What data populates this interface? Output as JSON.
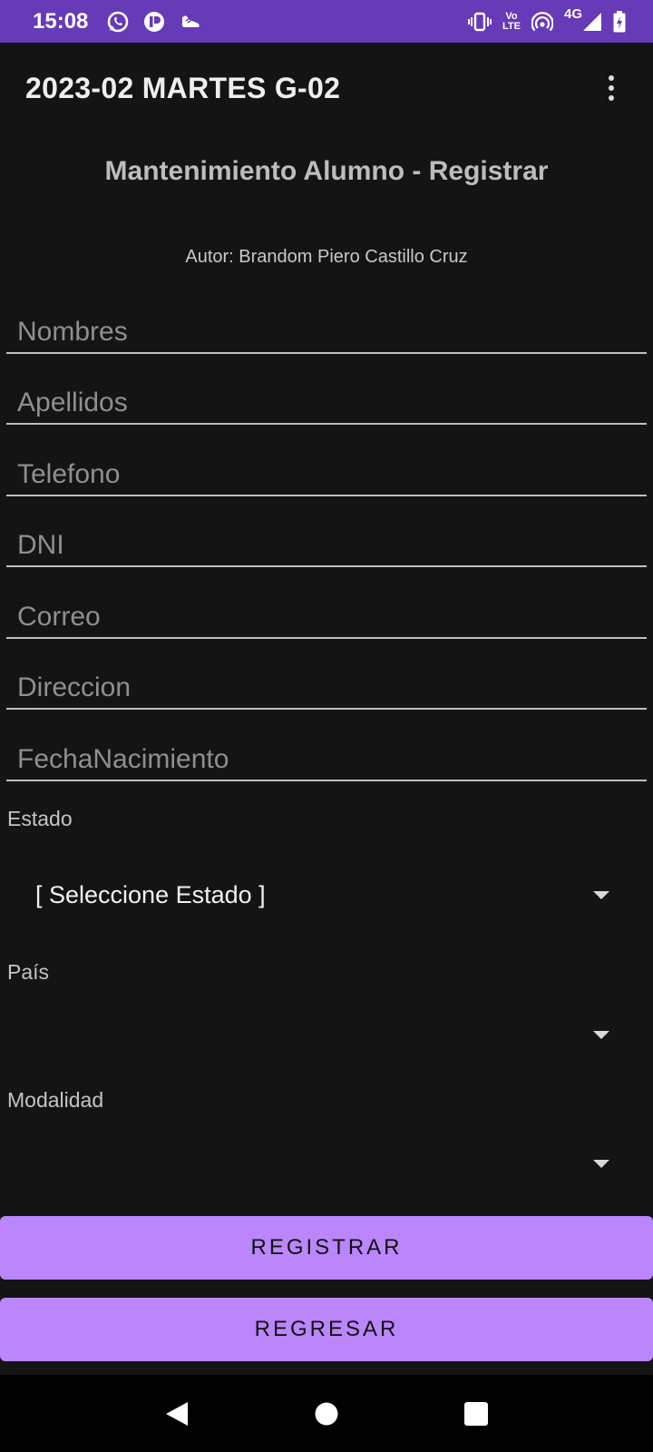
{
  "status_bar": {
    "time": "15:08",
    "left_icons": [
      "whatsapp-icon",
      "app-notification-icon",
      "shoe-icon"
    ],
    "right_icons": [
      "vibrate-icon",
      "volte-icon",
      "hotspot-icon",
      "signal-icon",
      "battery-icon"
    ],
    "volte_top": "Vo",
    "volte_bottom": "LTE",
    "network": "4G",
    "color": "#673ab7"
  },
  "app_bar": {
    "title": "2023-02 MARTES G-02",
    "menu_icon": "more-vert-icon"
  },
  "form": {
    "heading": "Mantenimiento Alumno - Registrar",
    "author": "Autor: Brandom Piero Castillo Cruz",
    "fields": {
      "nombres": {
        "placeholder": "Nombres",
        "value": ""
      },
      "apellidos": {
        "placeholder": "Apellidos",
        "value": ""
      },
      "telefono": {
        "placeholder": "Telefono",
        "value": ""
      },
      "dni": {
        "placeholder": "DNI",
        "value": ""
      },
      "correo": {
        "placeholder": "Correo",
        "value": ""
      },
      "direccion": {
        "placeholder": "Direccion",
        "value": ""
      },
      "fecha": {
        "placeholder": "FechaNacimiento",
        "value": ""
      }
    },
    "estado": {
      "label": "Estado",
      "selected": "[ Seleccione Estado ]"
    },
    "pais": {
      "label": "País",
      "selected": ""
    },
    "modalidad": {
      "label": "Modalidad",
      "selected": ""
    }
  },
  "buttons": {
    "registrar": "REGISTRAR",
    "regresar": "REGRESAR",
    "accent": "#bb86fc"
  },
  "nav_bar": {
    "icons": [
      "back-icon",
      "home-icon",
      "recents-icon"
    ]
  }
}
